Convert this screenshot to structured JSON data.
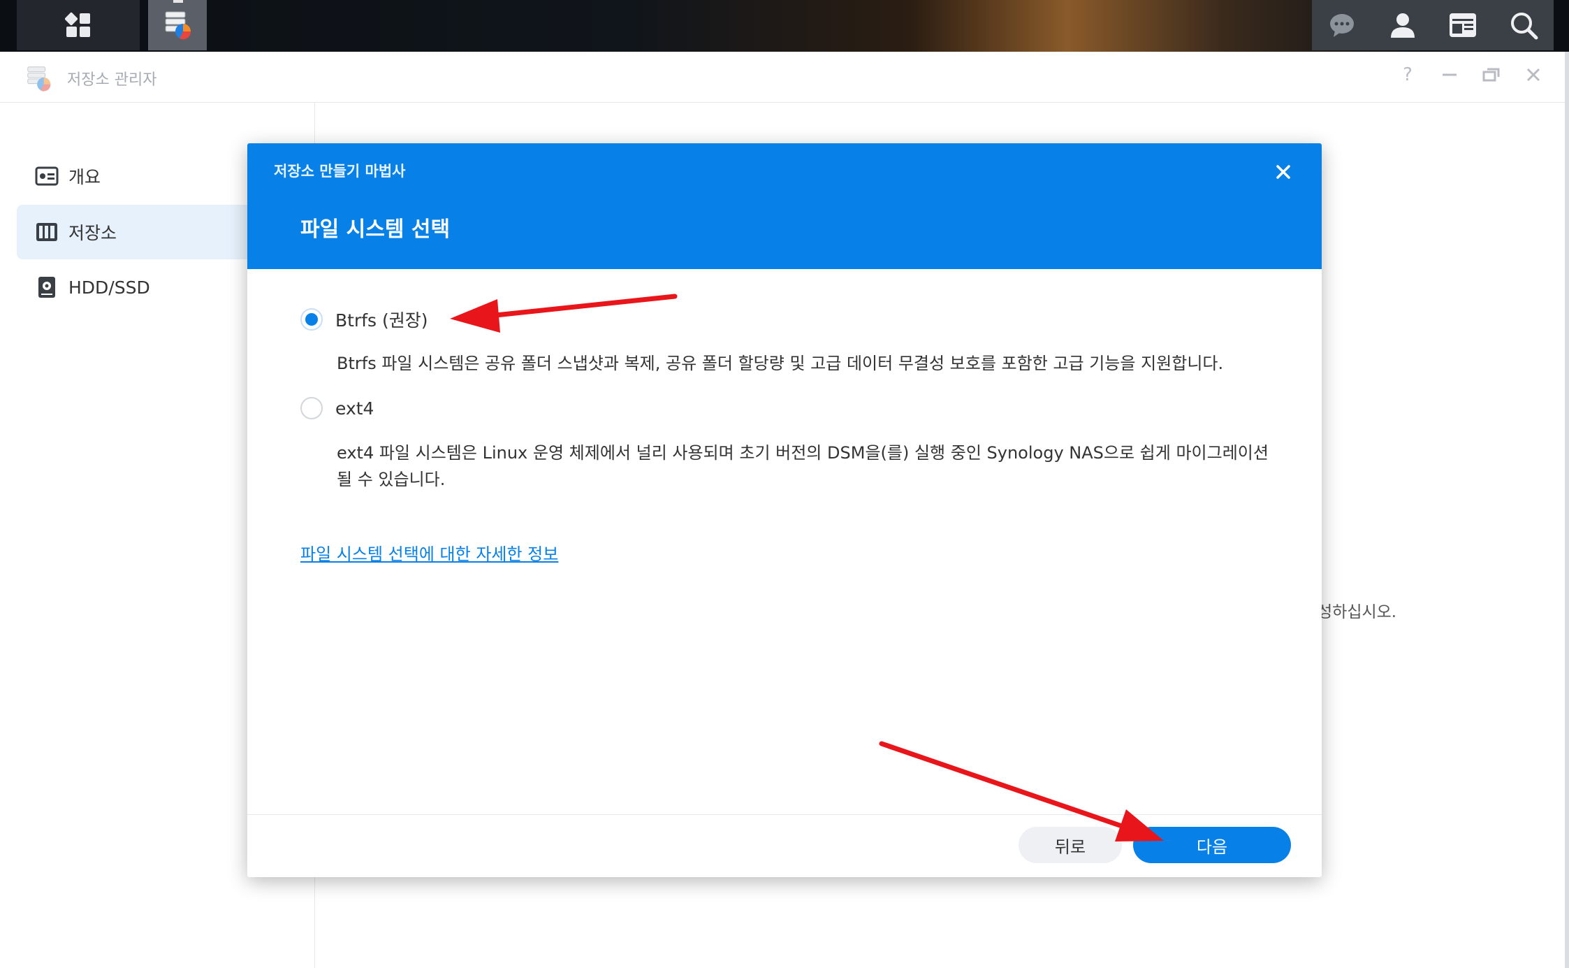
{
  "taskbar": {
    "main_menu_icon": "grid-icon",
    "active_app_icon": "storage-manager-icon",
    "right_icons": [
      "chat-icon",
      "user-icon",
      "widgets-icon",
      "search-icon"
    ]
  },
  "window": {
    "title": "저장소 관리자",
    "controls": [
      "help-icon",
      "minimize-icon",
      "restore-icon",
      "close-icon"
    ]
  },
  "sidebar": {
    "items": [
      {
        "label": "개요",
        "icon": "overview-icon",
        "active": false
      },
      {
        "label": "저장소",
        "icon": "storage-icon",
        "active": true
      },
      {
        "label": "HDD/SSD",
        "icon": "hdd-icon",
        "active": false
      }
    ]
  },
  "background": {
    "hint_text": "성하십시오."
  },
  "wizard": {
    "subtitle": "저장소 만들기 마법사",
    "title": "파일 시스템 선택",
    "options": [
      {
        "label": "Btrfs (권장)",
        "checked": true,
        "description": "Btrfs 파일 시스템은 공유 폴더 스냅샷과 복제, 공유 폴더 할당량 및 고급 데이터 무결성 보호를 포함한 고급 기능을 지원합니다."
      },
      {
        "label": "ext4",
        "checked": false,
        "description": "ext4 파일 시스템은 Linux 운영 체제에서 널리 사용되며 초기 버전의 DSM을(를) 실행 중인 Synology NAS으로 쉽게 마이그레이션될 수 있습니다."
      }
    ],
    "more_info_link": "파일 시스템 선택에 대한 자세한 정보",
    "back_button": "뒤로",
    "next_button": "다음"
  },
  "colors": {
    "accent": "#0781e8",
    "annotation": "#e8161b"
  }
}
